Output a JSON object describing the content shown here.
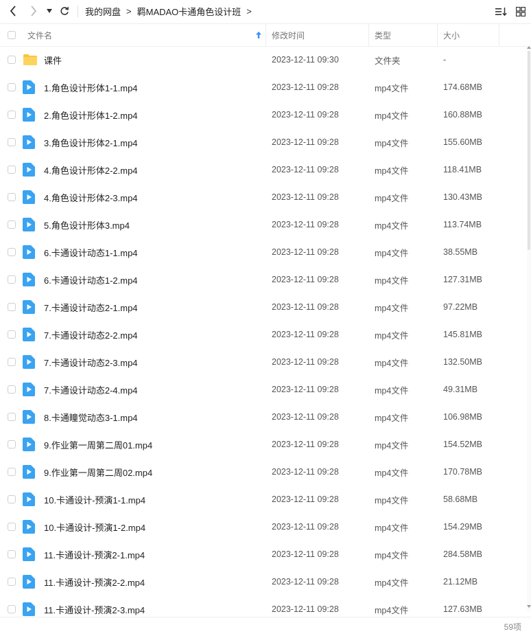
{
  "toolbar": {
    "breadcrumb": [
      "我的网盘",
      "羁MADAO卡通角色设计班"
    ],
    "icons": {
      "back": "back-icon",
      "forward": "forward-icon",
      "history": "history-dropdown-icon",
      "refresh": "refresh-icon",
      "sort": "sort-icon",
      "grid": "grid-view-icon"
    }
  },
  "columns": {
    "name": "文件名",
    "modified": "修改时间",
    "type": "类型",
    "size": "大小"
  },
  "colors": {
    "folder": "#f9c53d",
    "video": "#3aa3f2",
    "accent": "#3a8ef6"
  },
  "files": [
    {
      "name": "课件",
      "modified": "2023-12-11 09:30",
      "type": "文件夹",
      "size": "-",
      "kind": "folder"
    },
    {
      "name": "1.角色设计形体1-1.mp4",
      "modified": "2023-12-11 09:28",
      "type": "mp4文件",
      "size": "174.68MB",
      "kind": "video"
    },
    {
      "name": "2.角色设计形体1-2.mp4",
      "modified": "2023-12-11 09:28",
      "type": "mp4文件",
      "size": "160.88MB",
      "kind": "video"
    },
    {
      "name": "3.角色设计形体2-1.mp4",
      "modified": "2023-12-11 09:28",
      "type": "mp4文件",
      "size": "155.60MB",
      "kind": "video"
    },
    {
      "name": "4.角色设计形体2-2.mp4",
      "modified": "2023-12-11 09:28",
      "type": "mp4文件",
      "size": "118.41MB",
      "kind": "video"
    },
    {
      "name": "4.角色设计形体2-3.mp4",
      "modified": "2023-12-11 09:28",
      "type": "mp4文件",
      "size": "130.43MB",
      "kind": "video"
    },
    {
      "name": "5.角色设计形体3.mp4",
      "modified": "2023-12-11 09:28",
      "type": "mp4文件",
      "size": "113.74MB",
      "kind": "video"
    },
    {
      "name": "6.卡通设计动态1-1.mp4",
      "modified": "2023-12-11 09:28",
      "type": "mp4文件",
      "size": "38.55MB",
      "kind": "video"
    },
    {
      "name": "6.卡通设计动态1-2.mp4",
      "modified": "2023-12-11 09:28",
      "type": "mp4文件",
      "size": "127.31MB",
      "kind": "video"
    },
    {
      "name": "7.卡通设计动态2-1.mp4",
      "modified": "2023-12-11 09:28",
      "type": "mp4文件",
      "size": "97.22MB",
      "kind": "video"
    },
    {
      "name": "7.卡通设计动态2-2.mp4",
      "modified": "2023-12-11 09:28",
      "type": "mp4文件",
      "size": "145.81MB",
      "kind": "video"
    },
    {
      "name": "7.卡通设计动态2-3.mp4",
      "modified": "2023-12-11 09:28",
      "type": "mp4文件",
      "size": "132.50MB",
      "kind": "video"
    },
    {
      "name": "7.卡通设计动态2-4.mp4",
      "modified": "2023-12-11 09:28",
      "type": "mp4文件",
      "size": "49.31MB",
      "kind": "video"
    },
    {
      "name": "8.卡通瞳觉动态3-1.mp4",
      "modified": "2023-12-11 09:28",
      "type": "mp4文件",
      "size": "106.98MB",
      "kind": "video"
    },
    {
      "name": "9.作业第一周第二周01.mp4",
      "modified": "2023-12-11 09:28",
      "type": "mp4文件",
      "size": "154.52MB",
      "kind": "video"
    },
    {
      "name": "9.作业第一周第二周02.mp4",
      "modified": "2023-12-11 09:28",
      "type": "mp4文件",
      "size": "170.78MB",
      "kind": "video"
    },
    {
      "name": "10.卡通设计-预演1-1.mp4",
      "modified": "2023-12-11 09:28",
      "type": "mp4文件",
      "size": "58.68MB",
      "kind": "video"
    },
    {
      "name": "10.卡通设计-预演1-2.mp4",
      "modified": "2023-12-11 09:28",
      "type": "mp4文件",
      "size": "154.29MB",
      "kind": "video"
    },
    {
      "name": "11.卡通设计-预演2-1.mp4",
      "modified": "2023-12-11 09:28",
      "type": "mp4文件",
      "size": "284.58MB",
      "kind": "video"
    },
    {
      "name": "11.卡通设计-预演2-2.mp4",
      "modified": "2023-12-11 09:28",
      "type": "mp4文件",
      "size": "21.12MB",
      "kind": "video"
    },
    {
      "name": "11.卡通设计-预演2-3.mp4",
      "modified": "2023-12-11 09:28",
      "type": "mp4文件",
      "size": "127.63MB",
      "kind": "video"
    }
  ],
  "footer": {
    "count": "59项"
  }
}
